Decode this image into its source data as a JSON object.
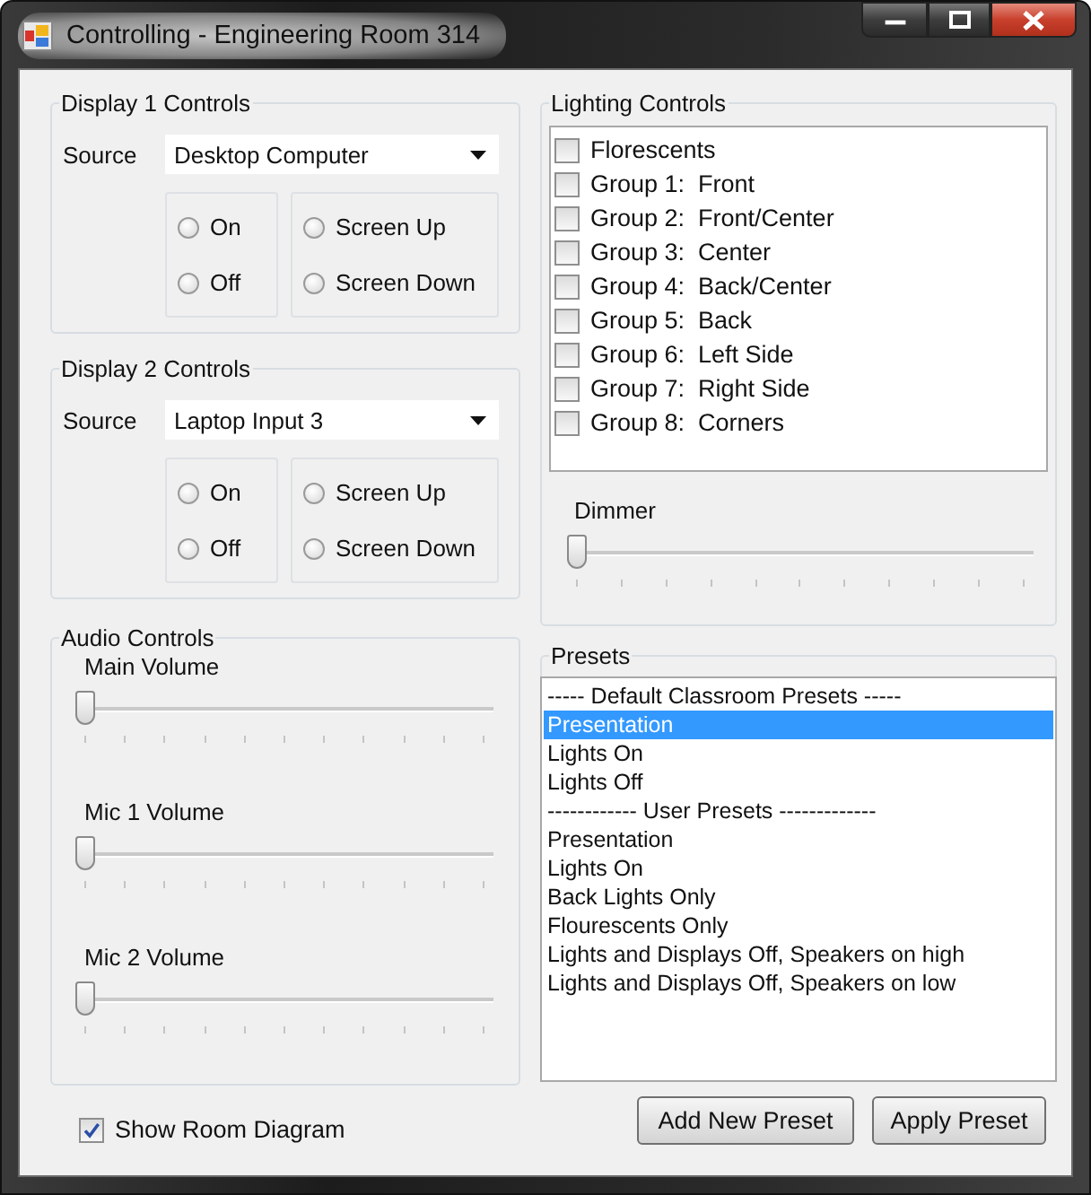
{
  "window": {
    "title": "Controlling - Engineering Room 314"
  },
  "displays": [
    {
      "title": "Display 1 Controls",
      "source_label": "Source",
      "source": "Desktop Computer",
      "power": [
        {
          "label": "On",
          "selected": false
        },
        {
          "label": "Off",
          "selected": false
        }
      ],
      "screen": [
        {
          "label": "Screen Up",
          "selected": false
        },
        {
          "label": "Screen Down",
          "selected": false
        }
      ]
    },
    {
      "title": "Display 2 Controls",
      "source_label": "Source",
      "source": "Laptop Input 3",
      "power": [
        {
          "label": "On",
          "selected": false
        },
        {
          "label": "Off",
          "selected": false
        }
      ],
      "screen": [
        {
          "label": "Screen Up",
          "selected": false
        },
        {
          "label": "Screen Down",
          "selected": false
        }
      ]
    }
  ],
  "audio": {
    "title": "Audio Controls",
    "sliders": [
      {
        "label": "Main Volume",
        "level": 0
      },
      {
        "label": "Mic 1 Volume",
        "level": 0
      },
      {
        "label": "Mic 2 Volume",
        "level": 0
      }
    ]
  },
  "show_room_diagram": {
    "label": "Show Room Diagram",
    "checked": true
  },
  "lighting": {
    "title": "Lighting Controls",
    "items": [
      {
        "label": "Florescents",
        "checked": false
      },
      {
        "label": "Group 1:  Front",
        "checked": false
      },
      {
        "label": "Group 2:  Front/Center",
        "checked": false
      },
      {
        "label": "Group 3:  Center",
        "checked": false
      },
      {
        "label": "Group 4:  Back/Center",
        "checked": false
      },
      {
        "label": "Group 5:  Back",
        "checked": false
      },
      {
        "label": "Group 6:  Left Side",
        "checked": false
      },
      {
        "label": "Group 7:  Right Side",
        "checked": false
      },
      {
        "label": "Group 8:  Corners",
        "checked": false
      }
    ],
    "dimmer": {
      "label": "Dimmer",
      "level": 0
    }
  },
  "presets": {
    "title": "Presets",
    "items": [
      {
        "label": "----- Default Classroom Presets -----",
        "selected": false
      },
      {
        "label": "Presentation",
        "selected": true
      },
      {
        "label": "Lights On",
        "selected": false
      },
      {
        "label": "Lights Off",
        "selected": false
      },
      {
        "label": "------------ User Presets -------------",
        "selected": false
      },
      {
        "label": "Presentation",
        "selected": false
      },
      {
        "label": "Lights On",
        "selected": false
      },
      {
        "label": "Back Lights Only",
        "selected": false
      },
      {
        "label": "Flourescents Only",
        "selected": false
      },
      {
        "label": "Lights and Displays Off, Speakers on high",
        "selected": false
      },
      {
        "label": "Lights and Displays Off, Speakers on low",
        "selected": false
      }
    ]
  },
  "buttons": [
    "Add New Preset",
    "Apply Preset"
  ]
}
